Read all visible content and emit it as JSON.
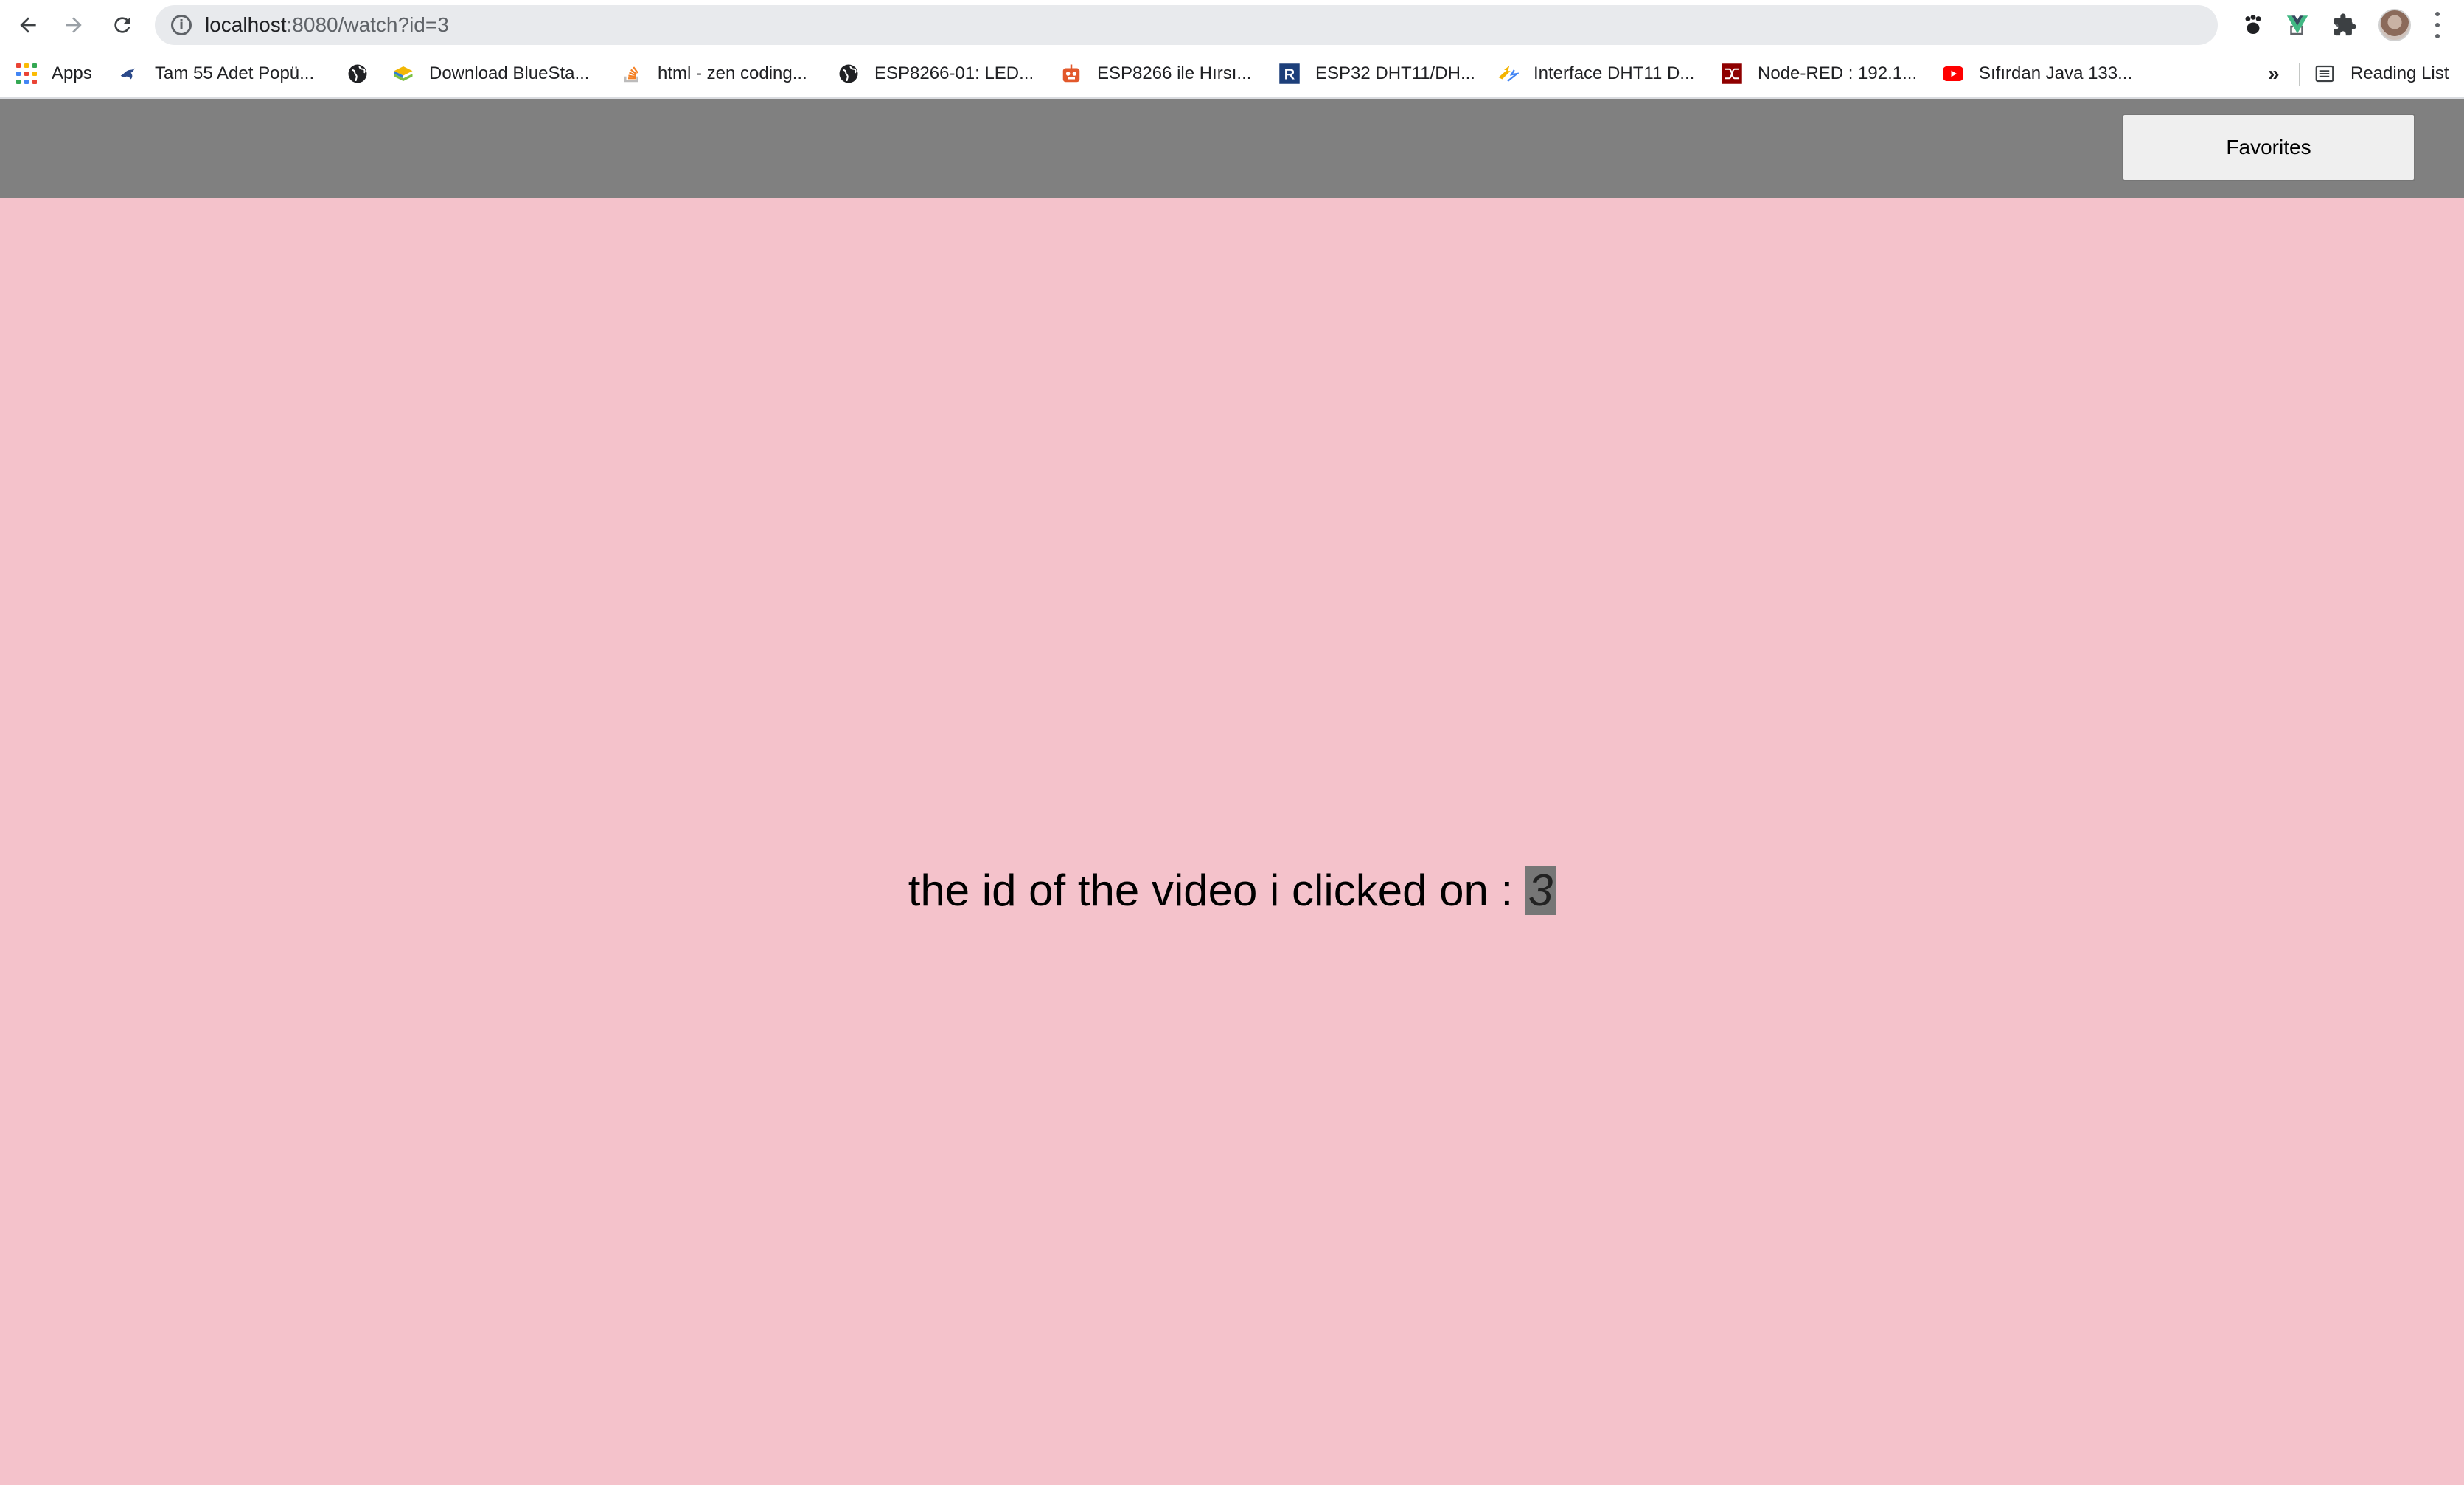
{
  "browser": {
    "url_host": "localhost",
    "url_rest": ":8080/watch?id=3",
    "bookmarks": [
      {
        "label": "Apps",
        "icon": "apps-grid-icon"
      },
      {
        "label": "Tam 55 Adet Popü...",
        "icon": "bird-icon"
      },
      {
        "label": "",
        "icon": "globe-icon"
      },
      {
        "label": "Download BlueSta...",
        "icon": "bluestacks-icon"
      },
      {
        "label": "html - zen coding...",
        "icon": "stackoverflow-icon"
      },
      {
        "label": "ESP8266-01: LED...",
        "icon": "globe-icon"
      },
      {
        "label": "ESP8266 ile Hırsı...",
        "icon": "robot-icon"
      },
      {
        "label": "ESP32 DHT11/DH...",
        "icon": "r-logo-icon"
      },
      {
        "label": "Interface DHT11 D...",
        "icon": "lightning-icon"
      },
      {
        "label": "Node-RED : 192.1...",
        "icon": "node-red-icon"
      },
      {
        "label": "Sıfırdan Java 133...",
        "icon": "youtube-icon"
      }
    ],
    "overflow_label": "»",
    "reading_list_label": "Reading List"
  },
  "header": {
    "favorites_label": "Favorites"
  },
  "main": {
    "message": "the id of the video i clicked on : ",
    "video_id": "3"
  },
  "colors": {
    "page_background": "#f4c2cb",
    "header_background": "#808080"
  }
}
